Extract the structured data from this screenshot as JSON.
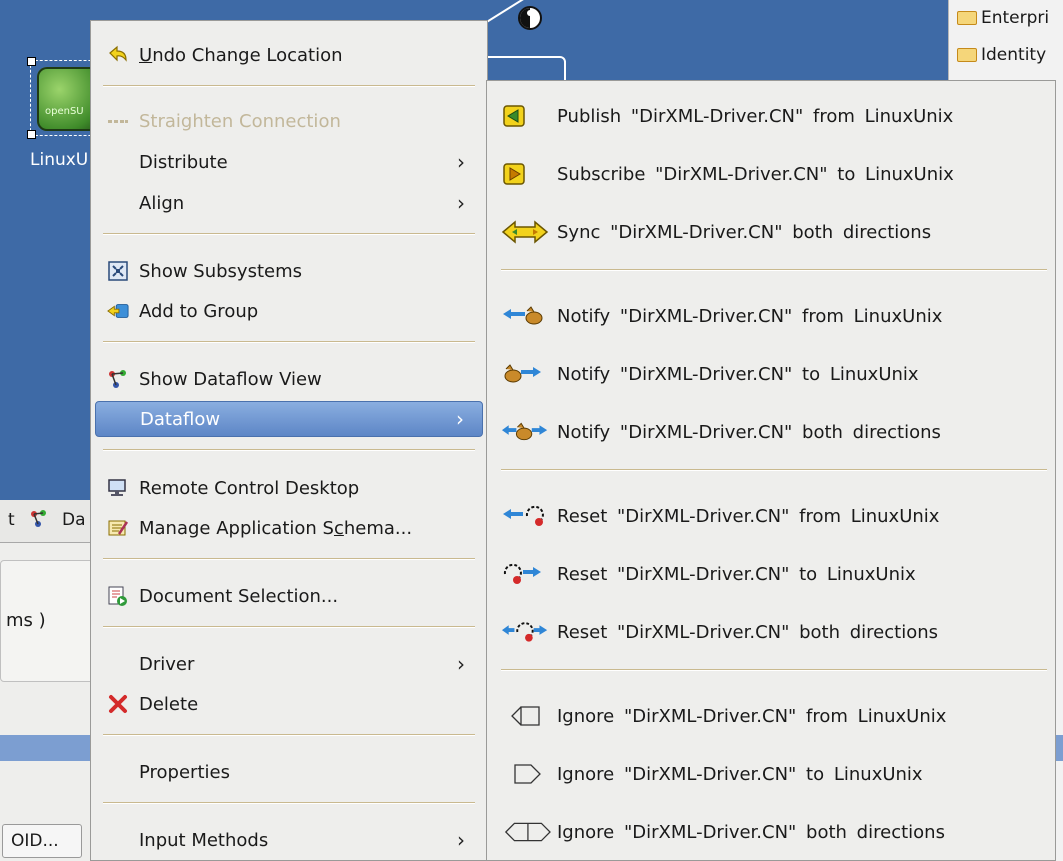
{
  "canvas": {
    "node_label": "LinuxU",
    "node_logo_text": "openSU"
  },
  "right_panel": {
    "items": [
      {
        "label": "Enterpri",
        "icon": "folder-icon"
      },
      {
        "label": "Identity",
        "icon": "folder-icon"
      }
    ]
  },
  "left_lower": {
    "tab_text": "t",
    "tab_label": "Da",
    "ms_text": "ms )",
    "oid_button": "OID..."
  },
  "context_menu": {
    "items": [
      {
        "id": "undo",
        "label": "Undo Change Location",
        "icon": "undo-icon"
      },
      {
        "id": "straighten",
        "label": "Straighten Connection",
        "icon": "straighten-icon",
        "disabled": true
      },
      {
        "id": "distribute",
        "label": "Distribute",
        "submenu": true
      },
      {
        "id": "align",
        "label": "Align",
        "submenu": true
      },
      {
        "id": "show_subsystems",
        "label": "Show Subsystems",
        "icon": "subsystems-icon"
      },
      {
        "id": "add_to_group",
        "label": "Add to Group",
        "icon": "add-group-icon"
      },
      {
        "id": "show_dataflow",
        "label": "Show Dataflow View",
        "icon": "dataflow-icon"
      },
      {
        "id": "dataflow",
        "label": "Dataflow",
        "submenu": true,
        "active": true
      },
      {
        "id": "remote_control",
        "label": "Remote Control Desktop",
        "icon": "monitor-icon"
      },
      {
        "id": "manage_schema",
        "label": "Manage Application Schema...",
        "icon": "schema-icon"
      },
      {
        "id": "document_selection",
        "label": "Document Selection...",
        "icon": "document-icon"
      },
      {
        "id": "driver",
        "label": "Driver",
        "submenu": true
      },
      {
        "id": "delete",
        "label": "Delete",
        "icon": "delete-icon"
      },
      {
        "id": "properties",
        "label": "Properties"
      },
      {
        "id": "input_methods",
        "label": "Input Methods",
        "submenu": true
      }
    ],
    "arrow_glyph": "›"
  },
  "dataflow_submenu": {
    "items": [
      {
        "label": "Publish  \"DirXML-Driver.CN\"  from LinuxUnix",
        "icon": "publish-icon"
      },
      {
        "label": "Subscribe  \"DirXML-Driver.CN\"  to LinuxUnix",
        "icon": "subscribe-icon"
      },
      {
        "label": "Sync  \"DirXML-Driver.CN\"  both directions",
        "icon": "sync-icon"
      },
      {
        "label": "Notify  \"DirXML-Driver.CN\"  from LinuxUnix",
        "icon": "notify-from-icon"
      },
      {
        "label": "Notify  \"DirXML-Driver.CN\"  to LinuxUnix",
        "icon": "notify-to-icon"
      },
      {
        "label": "Notify  \"DirXML-Driver.CN\"  both directions",
        "icon": "notify-both-icon"
      },
      {
        "label": "Reset  \"DirXML-Driver.CN\"  from LinuxUnix",
        "icon": "reset-from-icon"
      },
      {
        "label": "Reset  \"DirXML-Driver.CN\"  to LinuxUnix",
        "icon": "reset-to-icon"
      },
      {
        "label": "Reset  \"DirXML-Driver.CN\"  both directions",
        "icon": "reset-both-icon"
      },
      {
        "label": "Ignore  \"DirXML-Driver.CN\"  from LinuxUnix",
        "icon": "ignore-from-icon"
      },
      {
        "label": "Ignore  \"DirXML-Driver.CN\"  to LinuxUnix",
        "icon": "ignore-to-icon"
      },
      {
        "label": "Ignore  \"DirXML-Driver.CN\"  both directions",
        "icon": "ignore-both-icon"
      }
    ]
  },
  "colors": {
    "canvas": "#3e6aa6",
    "menu_bg": "#eeeeec",
    "active_item": "#6f95d2",
    "separator": "#c9b98f",
    "disabled_text": "#c2b79a",
    "arrow_yellow": "#f2d21c",
    "notify_blue": "#2f86d6",
    "delete_red": "#d42a2a"
  }
}
